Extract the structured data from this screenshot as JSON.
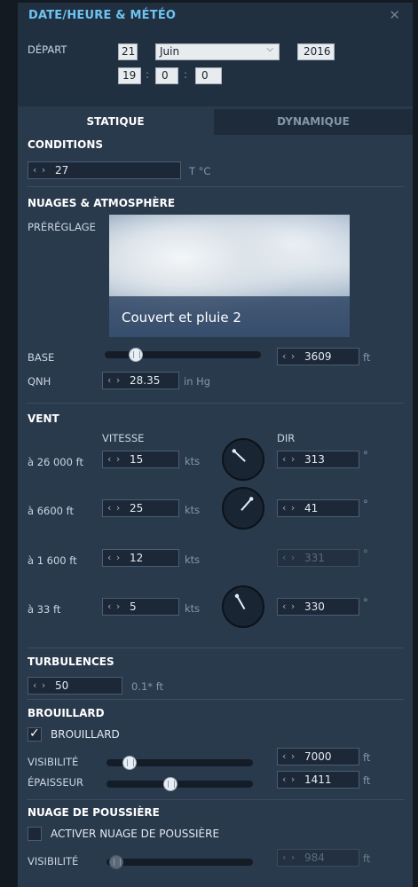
{
  "window": {
    "title": "DATE/HEURE & MÉTÉO",
    "close_icon": "close-icon"
  },
  "date": {
    "label": "DÉPART",
    "day": "21",
    "month": "Juin",
    "year": "2016",
    "hour": "19",
    "minute": "0",
    "second": "0"
  },
  "tabs": {
    "static": "STATIQUE",
    "dynamic": "DYNAMIQUE",
    "active": "static"
  },
  "conditions": {
    "title": "CONDITIONS",
    "temperature": "27",
    "temperature_unit": "T °C"
  },
  "clouds": {
    "title": "NUAGES & ATMOSPHÈRE",
    "preset_label": "PRÉRÉGLAGE",
    "preset_name": "Couvert et pluie 2",
    "base_label": "BASE",
    "base_value": "3609",
    "base_unit": "ft",
    "base_slider_fraction": 0.17,
    "qnh_label": "QNH",
    "qnh_value": "28.35",
    "qnh_unit": "in Hg"
  },
  "wind": {
    "title": "VENT",
    "speed_header": "VITESSE",
    "dir_header": "DIR",
    "speed_unit": "kts",
    "dir_unit": "°",
    "rows": [
      {
        "altitude": "à 26 000 ft",
        "speed": "15",
        "dir": "313",
        "dial_visible": true,
        "dir_enabled": true
      },
      {
        "altitude": "à 6600 ft",
        "speed": "25",
        "dir": "41",
        "dial_visible": true,
        "dir_enabled": true
      },
      {
        "altitude": "à 1 600 ft",
        "speed": "12",
        "dir": "331",
        "dial_visible": false,
        "dir_enabled": false
      },
      {
        "altitude": "à 33 ft",
        "speed": "5",
        "dir": "330",
        "dial_visible": true,
        "dir_enabled": true
      }
    ]
  },
  "turbulence": {
    "title": "TURBULENCES",
    "value": "50",
    "unit": "0.1* ft"
  },
  "fog": {
    "title": "BROUILLARD",
    "checkbox_label": "BROUILLARD",
    "checked": true,
    "visibility_label": "VISIBILITÉ",
    "visibility_value": "7000",
    "visibility_unit": "ft",
    "visibility_slider_fraction": 0.12,
    "thickness_label": "ÉPAISSEUR",
    "thickness_value": "1411",
    "thickness_unit": "ft",
    "thickness_slider_fraction": 0.43
  },
  "dust": {
    "title": "NUAGE DE POUSSIÈRE",
    "checkbox_label": "ACTIVER NUAGE DE POUSSIÈRE",
    "checked": false,
    "visibility_label": "VISIBILITÉ",
    "visibility_value": "984",
    "visibility_unit": "ft",
    "visibility_slider_fraction": 0.02
  },
  "colors": {
    "accent": "#6fc3f0",
    "panel": "#2a3a4d",
    "header": "#203041",
    "field": "#1c2837"
  }
}
